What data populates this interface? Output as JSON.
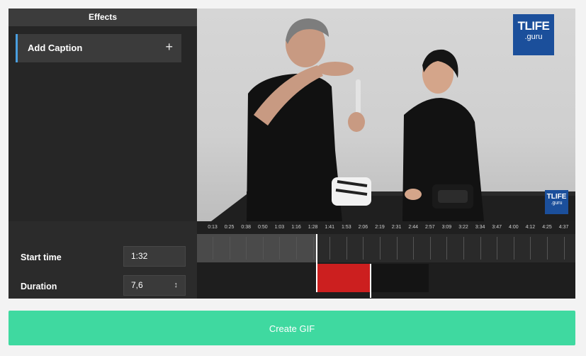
{
  "effects": {
    "title": "Effects",
    "add_caption_label": "Add Caption",
    "add_icon": "plus-icon"
  },
  "video": {
    "logo_line1": "TLIFE",
    "logo_line2": ".guru",
    "logo_small_line1": "TLIFE",
    "logo_small_line2": ".guru"
  },
  "settings": {
    "start_time_label": "Start time",
    "start_time_value": "1:32",
    "duration_label": "Duration",
    "duration_value": "7,6",
    "duration_icon": "stepper-icon"
  },
  "timeline": {
    "ticks": [
      "0:13",
      "0:25",
      "0:38",
      "0:50",
      "1:03",
      "1:16",
      "1:28",
      "1:41",
      "1:53",
      "2:06",
      "2:19",
      "2:31",
      "2:44",
      "2:57",
      "3:09",
      "3:22",
      "3:34",
      "3:47",
      "4:00",
      "4:12",
      "4:25",
      "4:37"
    ],
    "playhead_fraction": 0.317,
    "selection_start_fraction": 0.317,
    "selection_end_fraction": 0.459,
    "gray_end_fraction": 0.613,
    "selection_color": "#cc1f1f"
  },
  "actions": {
    "create_gif_label": "Create GIF",
    "create_gif_color": "#3fd9a0"
  }
}
